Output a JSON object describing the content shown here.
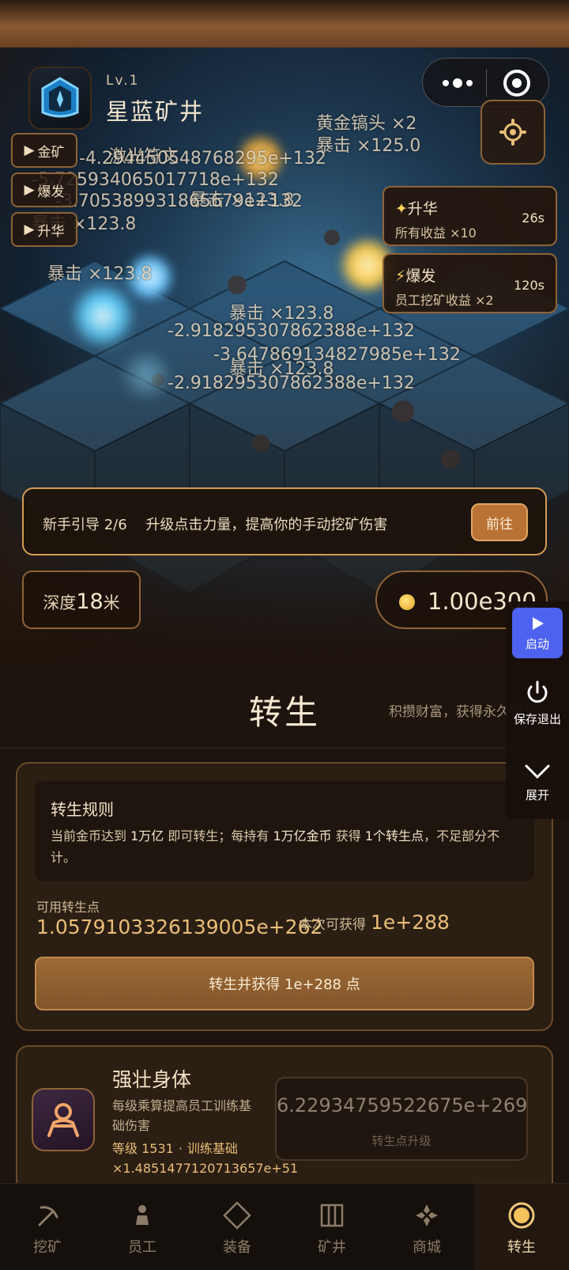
{
  "app": {
    "level": "Lv.1",
    "title": "星蓝矿井"
  },
  "side_buttons": [
    "金矿",
    "爆发",
    "升华"
  ],
  "buffs": [
    {
      "name": "升华",
      "desc": "所有收益 ×10",
      "time": "26s",
      "icon": "sparkle-icon"
    },
    {
      "name": "爆发",
      "desc": "员工挖矿收益 ×2",
      "time": "120s",
      "icon": "lightning-icon"
    }
  ],
  "scene_text": {
    "pickaxe": "黄金镐头 ×2",
    "laser": "激光符文",
    "crits": [
      "暴击 ×123.8",
      "暴击 ×123.8",
      "暴击 ×123.8",
      "暴击 ×123.8",
      "暴击 ×123.8",
      "暴击 ×125.0"
    ],
    "damage": [
      "-2.9182953078623​88e+132",
      "-3.6478691348279​85e+132",
      "-2.9182953078623​88e+132",
      "-4.2944505487682​95e+132",
      "-5.7259340650177​18e+132",
      "-3.7053899318656​79e+132"
    ]
  },
  "guide": {
    "step": "新手引导 2/6",
    "text": "升级点击力量，提高你的手动挖矿伤害",
    "button": "前往"
  },
  "depth": {
    "label": "深度",
    "value": "18",
    "unit": "米"
  },
  "coins": {
    "value": "1.00e300"
  },
  "float_panel": {
    "start": "启动",
    "save_exit": "保存退出",
    "expand": "展开"
  },
  "page": {
    "title": "转生",
    "subtitle": "积攒财富，获得永久强化"
  },
  "rules": {
    "title": "转生规则",
    "p1": "当前金币达到",
    "amount1": "1万亿",
    "p2": "即可转生；每持有",
    "amount2": "1万亿金币",
    "p3": "获得",
    "amount3": "1个转生点",
    "p4": "，不足部分不计。"
  },
  "points": {
    "available_label": "可用转生点",
    "available_value": "1.0579103326139005e+262",
    "gain_label": "本次可获得",
    "gain_value": "1e+288"
  },
  "rebirth_button": "转生并获得 1e+288 点",
  "upgrade": {
    "name": "强壮身体",
    "desc": "每级乘算提高员工训练基础伤害",
    "level": "等级 1531",
    "dot": "·",
    "base": "训练基础 ×1.4851477120713657e+51",
    "cost": "6.22934759522675e+269",
    "cost_label": "转生点升级"
  },
  "nav": [
    {
      "label": "挖矿",
      "icon": "pickaxe-icon"
    },
    {
      "label": "员工",
      "icon": "worker-icon"
    },
    {
      "label": "装备",
      "icon": "diamond-icon"
    },
    {
      "label": "矿井",
      "icon": "mine-shaft-icon"
    },
    {
      "label": "商城",
      "icon": "shop-icon"
    },
    {
      "label": "转生",
      "icon": "rebirth-icon",
      "active": true
    }
  ],
  "colors": {
    "accent": "#e9be78",
    "border": "#8f6335",
    "panel": "#2b1e13",
    "start_blue": "#4e62f0"
  }
}
